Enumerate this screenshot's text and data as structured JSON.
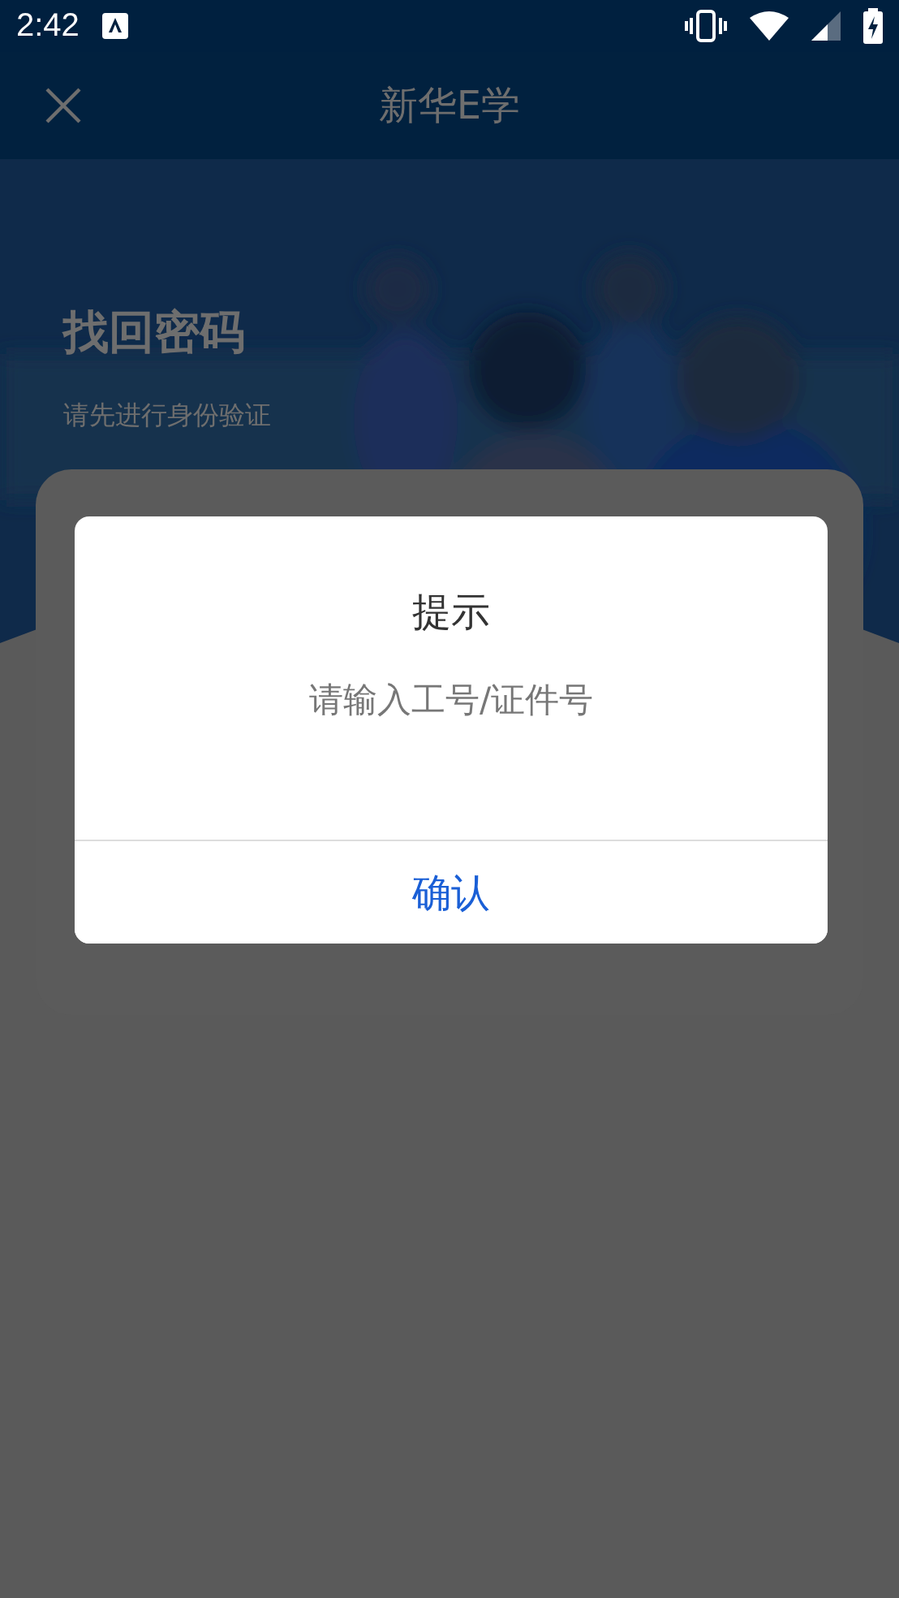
{
  "status_bar": {
    "time": "2:42"
  },
  "app_bar": {
    "title": "新华E学"
  },
  "header": {
    "title": "找回密码",
    "subtitle": "请先进行身份验证"
  },
  "dialog": {
    "title": "提示",
    "message": "请输入工号/证件号",
    "button": "确认"
  }
}
